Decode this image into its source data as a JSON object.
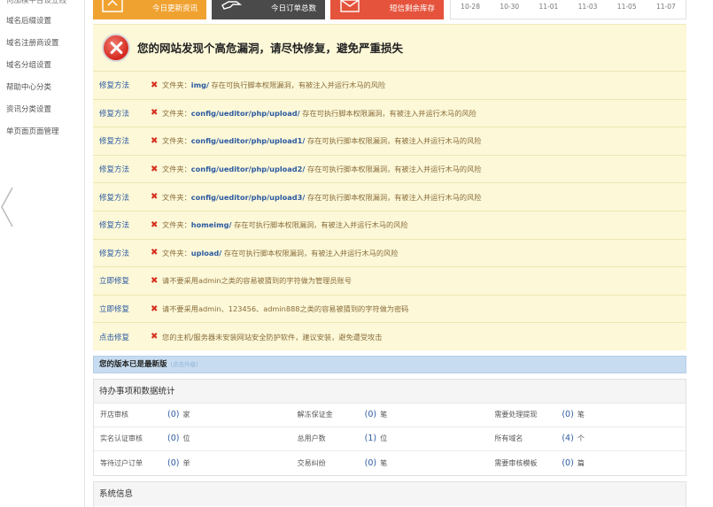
{
  "sidebar": {
    "items": [
      "何加模平台设立线",
      "域名后缀设置",
      "域名注册商设置",
      "域名分组设置",
      "帮助中心分类",
      "资讯分类设置",
      "单页面页面管理"
    ]
  },
  "cards": [
    {
      "label": "今日更新资讯",
      "icon": "upload-icon",
      "color": "#f0a231"
    },
    {
      "label": "今日订单总数",
      "icon": "hand-icon",
      "color": "#4a4a4a"
    },
    {
      "label": "短信剩余库存",
      "icon": "mail-icon",
      "color": "#e5533c"
    }
  ],
  "dates": [
    "10-28",
    "10-30",
    "11-01",
    "11-03",
    "11-05",
    "11-07"
  ],
  "alert": {
    "title": "您的网站发现个高危漏洞，请尽快修复，避免严重损失"
  },
  "vulns": [
    {
      "action": "修复方法",
      "pre": "文件夹：",
      "path": "img/",
      "desc": "存在可执行脚本权限漏洞，有被注入并运行木马的风险"
    },
    {
      "action": "修复方法",
      "pre": "文件夹：",
      "path": "config/ueditor/php/upload/",
      "desc": "存在可执行脚本权限漏洞，有被注入并运行木马的风险"
    },
    {
      "action": "修复方法",
      "pre": "文件夹：",
      "path": "config/ueditor/php/upload1/",
      "desc": "存在可执行脚本权限漏洞，有被注入并运行木马的风险"
    },
    {
      "action": "修复方法",
      "pre": "文件夹：",
      "path": "config/ueditor/php/upload2/",
      "desc": "存在可执行脚本权限漏洞，有被注入并运行木马的风险"
    },
    {
      "action": "修复方法",
      "pre": "文件夹：",
      "path": "config/ueditor/php/upload3/",
      "desc": "存在可执行脚本权限漏洞，有被注入并运行木马的风险"
    },
    {
      "action": "修复方法",
      "pre": "文件夹：",
      "path": "homeimg/",
      "desc": "存在可执行脚本权限漏洞，有被注入并运行木马的风险"
    },
    {
      "action": "修复方法",
      "pre": "文件夹：",
      "path": "upload/",
      "desc": "存在可执行脚本权限漏洞，有被注入并运行木马的风险"
    },
    {
      "action": "立即修复",
      "pre": "",
      "path": "",
      "desc": "请不要采用admin之类的容易被猜到的字符做为管理员账号"
    },
    {
      "action": "立即修复",
      "pre": "",
      "path": "",
      "desc": "请不要采用admin、123456、admin888之类的容易被猜到的字符做为密码"
    },
    {
      "action": "点击修复",
      "pre": "",
      "path": "",
      "desc": "您的主机/服务器未安装网站安全防护软件，建议安装，避免遭受攻击"
    }
  ],
  "version": {
    "text": "您的版本已是最新版",
    "sub": "(点击升级)"
  },
  "todo": {
    "title": "待办事项和数据统计",
    "rows": [
      [
        {
          "label": "开店审核",
          "value": "(0)",
          "unit": "家"
        },
        {
          "label": "解冻保证金",
          "value": "(0)",
          "unit": "笔"
        },
        {
          "label": "需要处理提现",
          "value": "(0)",
          "unit": "笔"
        }
      ],
      [
        {
          "label": "实名认证审核",
          "value": "(0)",
          "unit": "位"
        },
        {
          "label": "总用户数",
          "value": "(1)",
          "unit": "位"
        },
        {
          "label": "所有域名",
          "value": "(4)",
          "unit": "个"
        }
      ],
      [
        {
          "label": "等待过户订单",
          "value": "(0)",
          "unit": "单"
        },
        {
          "label": "交易纠纷",
          "value": "(0)",
          "unit": "笔"
        },
        {
          "label": "需要审核模板",
          "value": "(0)",
          "unit": "篇"
        }
      ]
    ]
  },
  "system": {
    "title": "系统信息"
  }
}
